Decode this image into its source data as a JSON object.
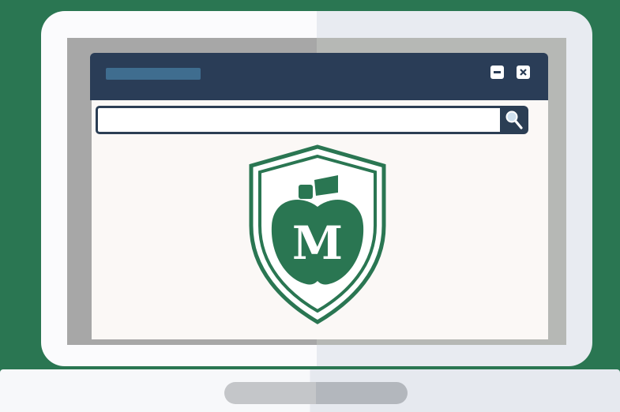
{
  "window": {
    "title": "",
    "controls": {
      "minimize_icon": "minimize-icon",
      "close_icon": "close-icon"
    }
  },
  "search": {
    "value": "",
    "placeholder": "",
    "button_icon": "magnifier-icon"
  },
  "logo": {
    "letter": "M",
    "shape": "shield-apple",
    "color": "#2a7652"
  },
  "colors": {
    "background": "#2a7652",
    "titlebar": "#2a3d57",
    "title_placeholder": "#3f6d8f",
    "screen": "#fbf8f6"
  }
}
